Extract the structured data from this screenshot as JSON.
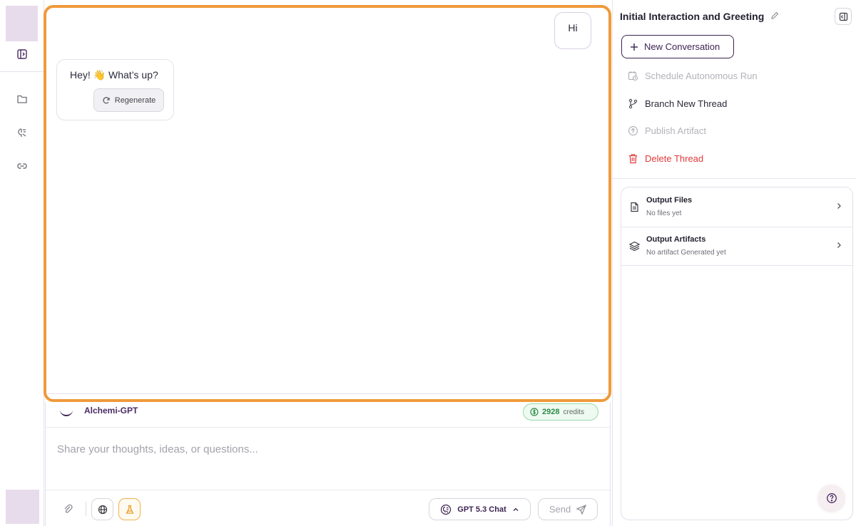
{
  "rail": {
    "icons": [
      "sidebar-toggle-icon",
      "folder-icon",
      "ai-brain-icon",
      "link-icon"
    ]
  },
  "chat": {
    "messages": [
      {
        "role": "user",
        "text": "Hi"
      },
      {
        "role": "assistant",
        "text": "Hey! 👋 What’s up?"
      }
    ],
    "regenerate_label": "Regenerate"
  },
  "composer": {
    "model_name": "Alchemi-GPT",
    "credits_value": "2928",
    "credits_label": "credits",
    "placeholder": "Share your thoughts, ideas, or questions...",
    "model_select_label": "GPT 5.3 Chat",
    "send_label": "Send"
  },
  "right_panel": {
    "title": "Initial Interaction and Greeting",
    "new_conversation_label": "New Conversation",
    "actions": [
      {
        "label": "Schedule Autonomous Run",
        "state": "disabled",
        "icon": "calendar-clock-icon"
      },
      {
        "label": "Branch New Thread",
        "state": "normal",
        "icon": "git-branch-icon"
      },
      {
        "label": "Publish Artifact",
        "state": "disabled",
        "icon": "upload-circle-icon"
      },
      {
        "label": "Delete Thread",
        "state": "danger",
        "icon": "trash-icon"
      }
    ],
    "outputs": [
      {
        "title": "Output Files",
        "subtitle": "No files yet",
        "icon": "file-icon"
      },
      {
        "title": "Output Artifacts",
        "subtitle": "No artifact Generated yet",
        "icon": "layers-icon"
      }
    ]
  },
  "colors": {
    "accent_orange": "#ef9a3b",
    "brand_purple": "#3c2452",
    "danger_red": "#e0393a",
    "credits_green": "#2d8b49"
  }
}
